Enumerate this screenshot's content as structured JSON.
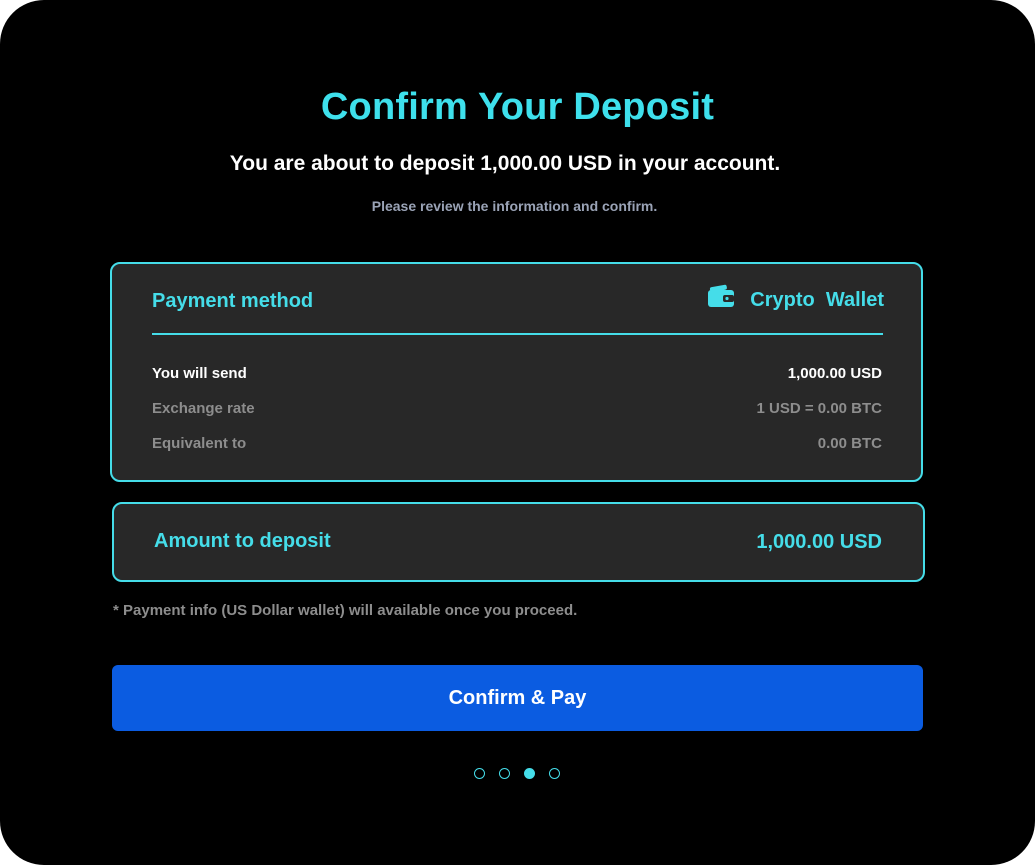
{
  "header": {
    "title": "Confirm Your Deposit",
    "subtitle": "You are about to deposit 1,000.00 USD in your account.",
    "hint": "Please review the information and confirm."
  },
  "payment_card": {
    "label": "Payment method",
    "method_icon": "wallet-icon",
    "method_name": "Crypto  Wallet",
    "rows": [
      {
        "label": "You will send",
        "value": "1,000.00 USD",
        "emphasis": "primary"
      },
      {
        "label": "Exchange rate",
        "value": "1 USD = 0.00 BTC",
        "emphasis": "secondary"
      },
      {
        "label": "Equivalent to",
        "value": "0.00 BTC",
        "emphasis": "secondary"
      }
    ]
  },
  "amount_card": {
    "label": "Amount to deposit",
    "value": "1,000.00 USD"
  },
  "note": "* Payment info (US Dollar wallet) will available once you proceed.",
  "confirm_button": {
    "label": "Confirm & Pay"
  },
  "pagination": {
    "total_steps": 4,
    "current_step": 3
  },
  "colors": {
    "accent": "#45dde9",
    "primary_button": "#0b5ce1",
    "card_background": "#282828",
    "page_background": "#000000"
  }
}
